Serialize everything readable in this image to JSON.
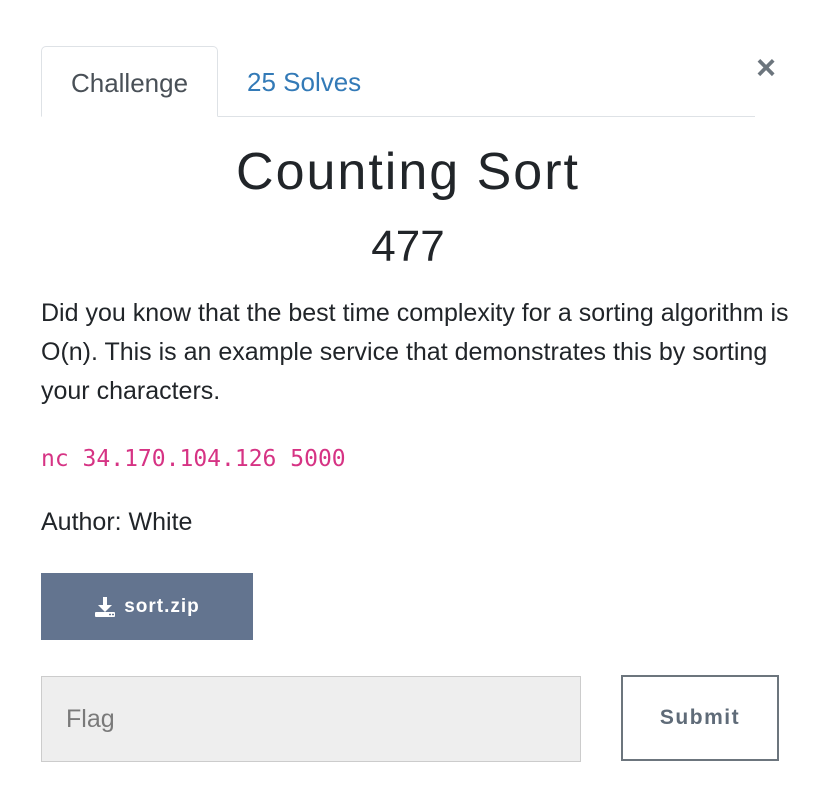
{
  "tabs": {
    "challenge_label": "Challenge",
    "solves_label": "25 Solves"
  },
  "close_symbol": "×",
  "challenge": {
    "name": "Counting Sort",
    "points": "477",
    "description": "Did you know that the best time complexity for a sorting algorithm is O(n). This is an example service that demonstrates this by sorting your characters.",
    "connection": "nc 34.170.104.126 5000",
    "author": "Author: White"
  },
  "files": {
    "download_label": "sort.zip",
    "icon": "download-icon"
  },
  "flag_form": {
    "placeholder": "Flag",
    "value": "",
    "submit_label": "Submit"
  },
  "colors": {
    "tab_link": "#337ab7",
    "command_text": "#d63384",
    "download_button_bg": "#63748f",
    "input_bg": "#eeeeee"
  }
}
